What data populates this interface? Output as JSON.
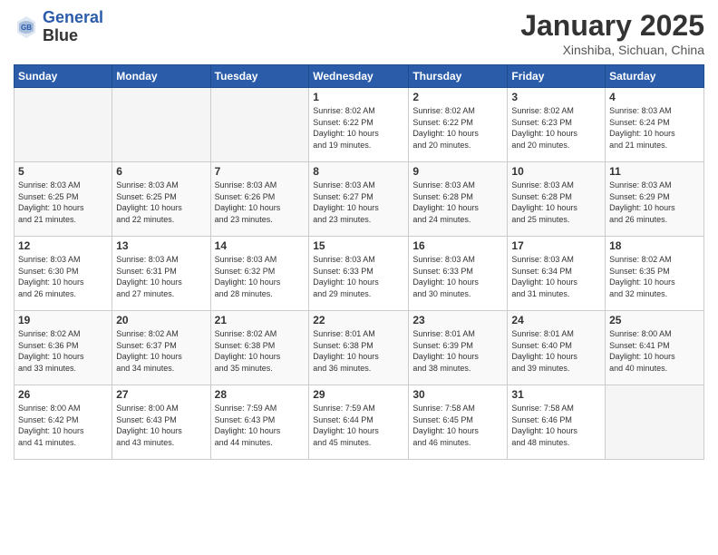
{
  "header": {
    "logo_line1": "General",
    "logo_line2": "Blue",
    "month_title": "January 2025",
    "location": "Xinshiba, Sichuan, China"
  },
  "weekdays": [
    "Sunday",
    "Monday",
    "Tuesday",
    "Wednesday",
    "Thursday",
    "Friday",
    "Saturday"
  ],
  "weeks": [
    [
      {
        "day": "",
        "info": ""
      },
      {
        "day": "",
        "info": ""
      },
      {
        "day": "",
        "info": ""
      },
      {
        "day": "1",
        "info": "Sunrise: 8:02 AM\nSunset: 6:22 PM\nDaylight: 10 hours\nand 19 minutes."
      },
      {
        "day": "2",
        "info": "Sunrise: 8:02 AM\nSunset: 6:22 PM\nDaylight: 10 hours\nand 20 minutes."
      },
      {
        "day": "3",
        "info": "Sunrise: 8:02 AM\nSunset: 6:23 PM\nDaylight: 10 hours\nand 20 minutes."
      },
      {
        "day": "4",
        "info": "Sunrise: 8:03 AM\nSunset: 6:24 PM\nDaylight: 10 hours\nand 21 minutes."
      }
    ],
    [
      {
        "day": "5",
        "info": "Sunrise: 8:03 AM\nSunset: 6:25 PM\nDaylight: 10 hours\nand 21 minutes."
      },
      {
        "day": "6",
        "info": "Sunrise: 8:03 AM\nSunset: 6:25 PM\nDaylight: 10 hours\nand 22 minutes."
      },
      {
        "day": "7",
        "info": "Sunrise: 8:03 AM\nSunset: 6:26 PM\nDaylight: 10 hours\nand 23 minutes."
      },
      {
        "day": "8",
        "info": "Sunrise: 8:03 AM\nSunset: 6:27 PM\nDaylight: 10 hours\nand 23 minutes."
      },
      {
        "day": "9",
        "info": "Sunrise: 8:03 AM\nSunset: 6:28 PM\nDaylight: 10 hours\nand 24 minutes."
      },
      {
        "day": "10",
        "info": "Sunrise: 8:03 AM\nSunset: 6:28 PM\nDaylight: 10 hours\nand 25 minutes."
      },
      {
        "day": "11",
        "info": "Sunrise: 8:03 AM\nSunset: 6:29 PM\nDaylight: 10 hours\nand 26 minutes."
      }
    ],
    [
      {
        "day": "12",
        "info": "Sunrise: 8:03 AM\nSunset: 6:30 PM\nDaylight: 10 hours\nand 26 minutes."
      },
      {
        "day": "13",
        "info": "Sunrise: 8:03 AM\nSunset: 6:31 PM\nDaylight: 10 hours\nand 27 minutes."
      },
      {
        "day": "14",
        "info": "Sunrise: 8:03 AM\nSunset: 6:32 PM\nDaylight: 10 hours\nand 28 minutes."
      },
      {
        "day": "15",
        "info": "Sunrise: 8:03 AM\nSunset: 6:33 PM\nDaylight: 10 hours\nand 29 minutes."
      },
      {
        "day": "16",
        "info": "Sunrise: 8:03 AM\nSunset: 6:33 PM\nDaylight: 10 hours\nand 30 minutes."
      },
      {
        "day": "17",
        "info": "Sunrise: 8:03 AM\nSunset: 6:34 PM\nDaylight: 10 hours\nand 31 minutes."
      },
      {
        "day": "18",
        "info": "Sunrise: 8:02 AM\nSunset: 6:35 PM\nDaylight: 10 hours\nand 32 minutes."
      }
    ],
    [
      {
        "day": "19",
        "info": "Sunrise: 8:02 AM\nSunset: 6:36 PM\nDaylight: 10 hours\nand 33 minutes."
      },
      {
        "day": "20",
        "info": "Sunrise: 8:02 AM\nSunset: 6:37 PM\nDaylight: 10 hours\nand 34 minutes."
      },
      {
        "day": "21",
        "info": "Sunrise: 8:02 AM\nSunset: 6:38 PM\nDaylight: 10 hours\nand 35 minutes."
      },
      {
        "day": "22",
        "info": "Sunrise: 8:01 AM\nSunset: 6:38 PM\nDaylight: 10 hours\nand 36 minutes."
      },
      {
        "day": "23",
        "info": "Sunrise: 8:01 AM\nSunset: 6:39 PM\nDaylight: 10 hours\nand 38 minutes."
      },
      {
        "day": "24",
        "info": "Sunrise: 8:01 AM\nSunset: 6:40 PM\nDaylight: 10 hours\nand 39 minutes."
      },
      {
        "day": "25",
        "info": "Sunrise: 8:00 AM\nSunset: 6:41 PM\nDaylight: 10 hours\nand 40 minutes."
      }
    ],
    [
      {
        "day": "26",
        "info": "Sunrise: 8:00 AM\nSunset: 6:42 PM\nDaylight: 10 hours\nand 41 minutes."
      },
      {
        "day": "27",
        "info": "Sunrise: 8:00 AM\nSunset: 6:43 PM\nDaylight: 10 hours\nand 43 minutes."
      },
      {
        "day": "28",
        "info": "Sunrise: 7:59 AM\nSunset: 6:43 PM\nDaylight: 10 hours\nand 44 minutes."
      },
      {
        "day": "29",
        "info": "Sunrise: 7:59 AM\nSunset: 6:44 PM\nDaylight: 10 hours\nand 45 minutes."
      },
      {
        "day": "30",
        "info": "Sunrise: 7:58 AM\nSunset: 6:45 PM\nDaylight: 10 hours\nand 46 minutes."
      },
      {
        "day": "31",
        "info": "Sunrise: 7:58 AM\nSunset: 6:46 PM\nDaylight: 10 hours\nand 48 minutes."
      },
      {
        "day": "",
        "info": ""
      }
    ]
  ]
}
